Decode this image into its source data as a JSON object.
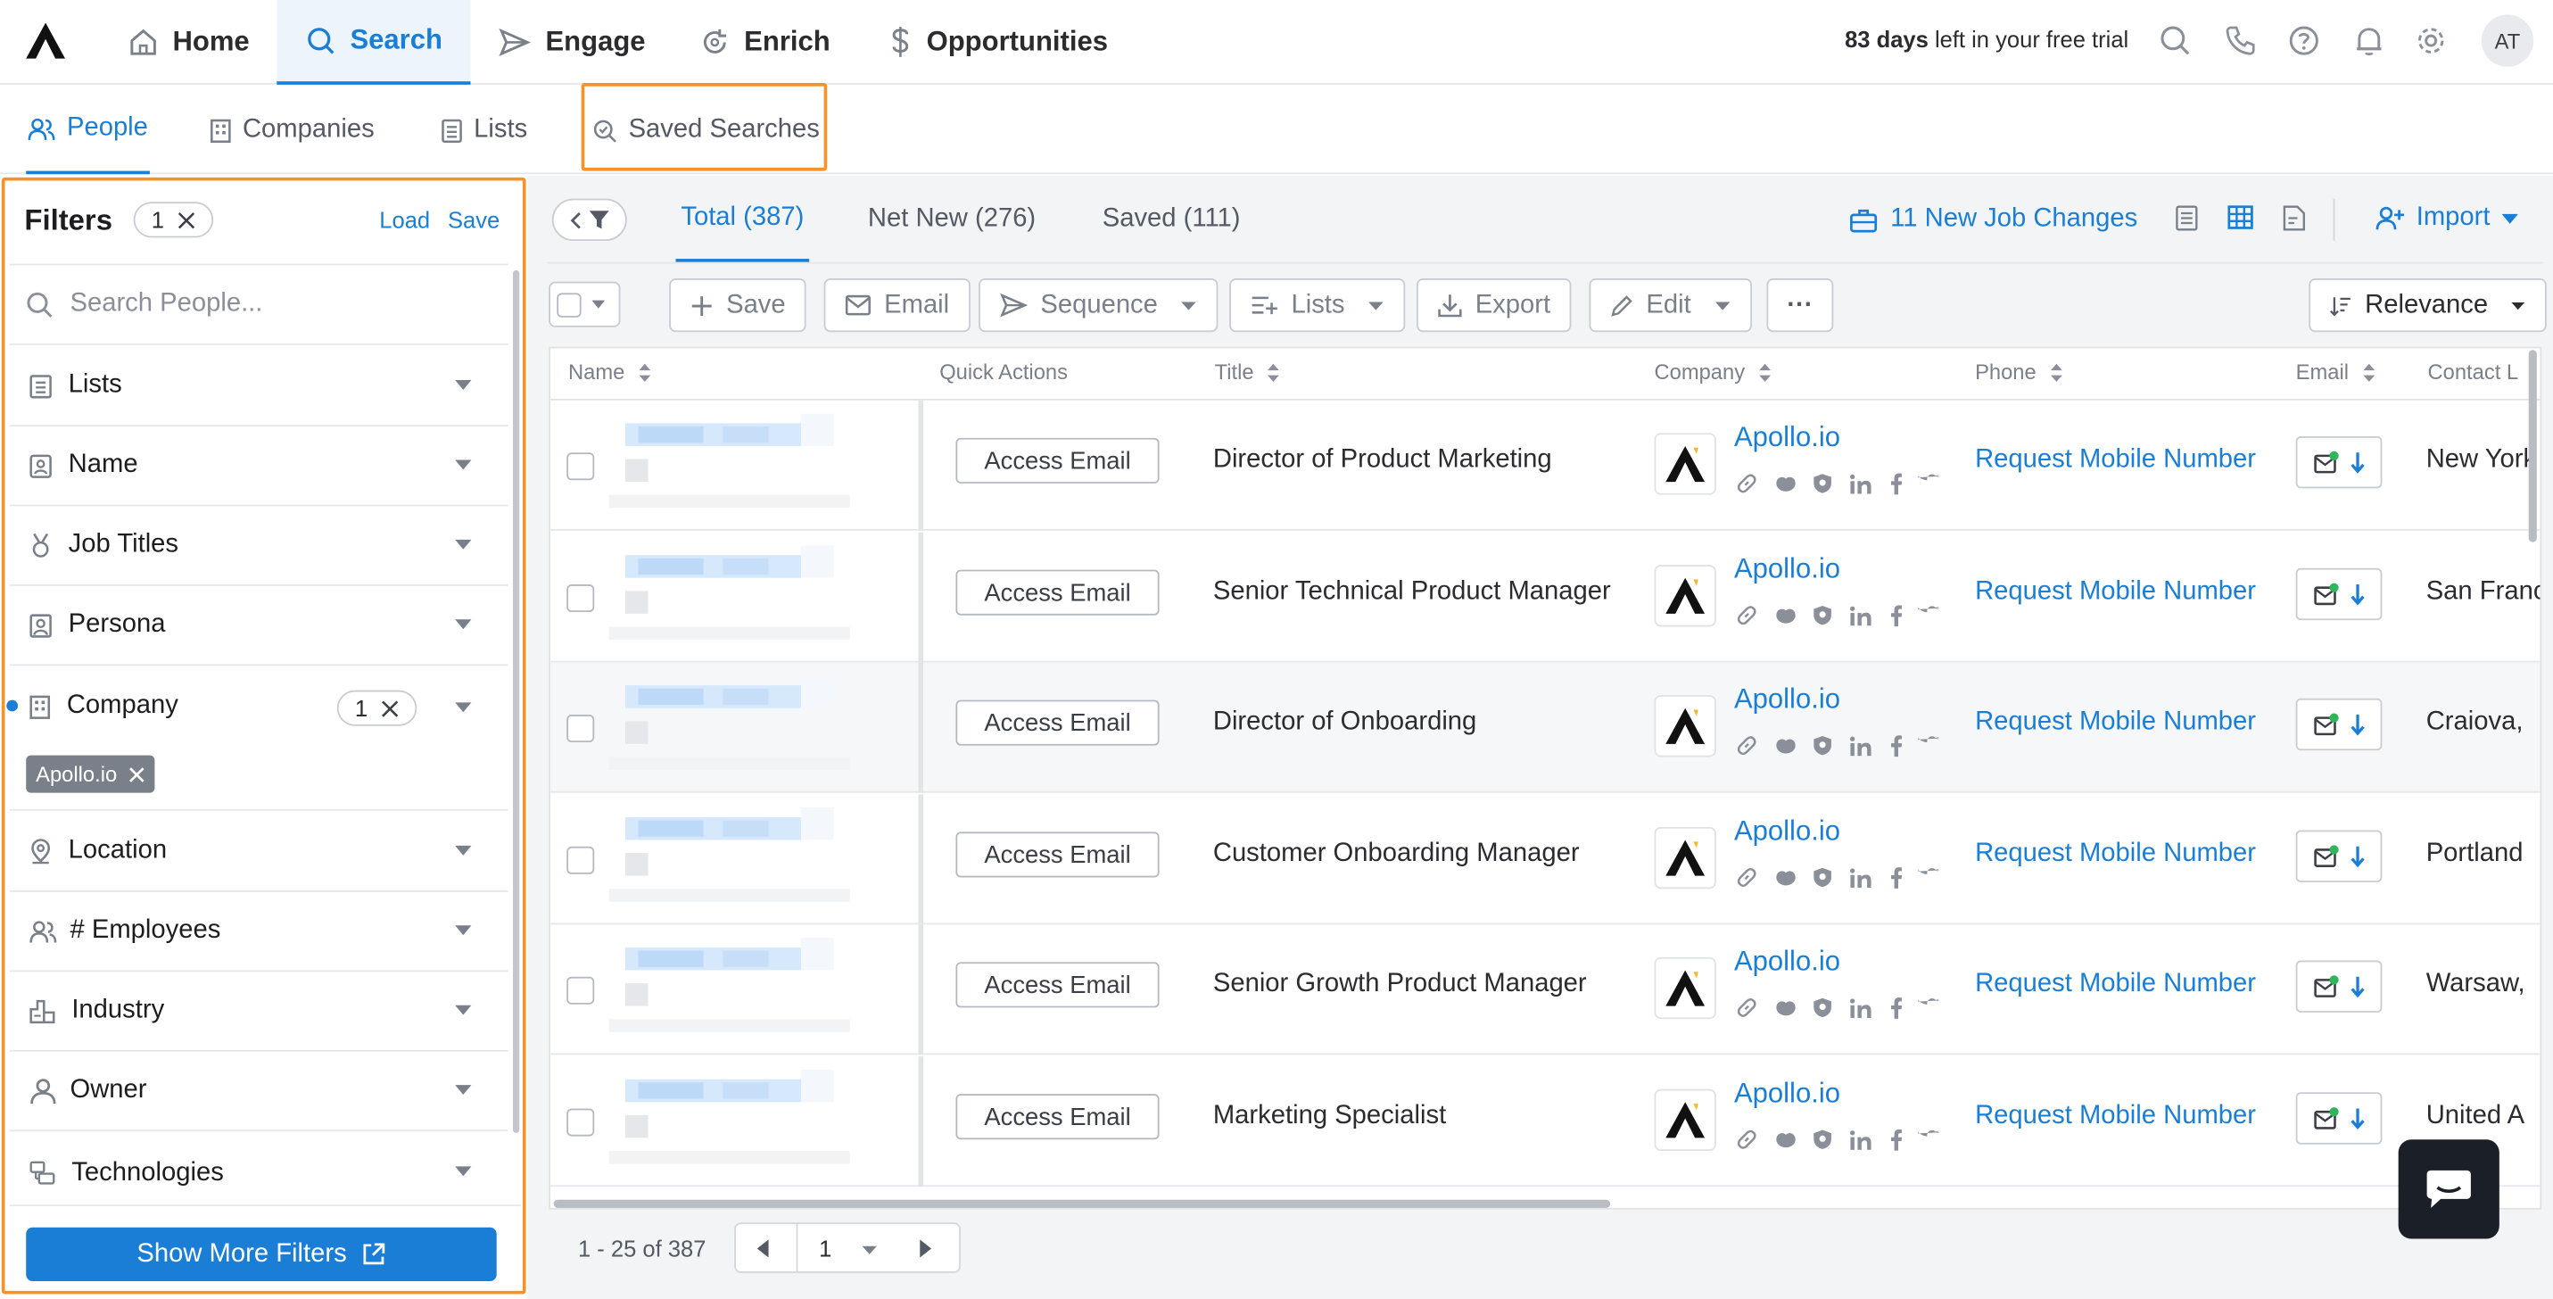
{
  "topnav": {
    "items": [
      {
        "label": "Home",
        "icon": "home-icon"
      },
      {
        "label": "Search",
        "icon": "search-icon"
      },
      {
        "label": "Engage",
        "icon": "send-icon"
      },
      {
        "label": "Enrich",
        "icon": "refresh-icon"
      },
      {
        "label": "Opportunities",
        "icon": "dollar-icon"
      }
    ],
    "trial_bold": "83 days",
    "trial_rest": " left in your free trial",
    "avatar": "AT"
  },
  "subnav": {
    "tabs": [
      {
        "label": "People",
        "icon": "people-icon"
      },
      {
        "label": "Companies",
        "icon": "building-icon"
      },
      {
        "label": "Lists",
        "icon": "list-icon"
      },
      {
        "label": "Saved Searches",
        "icon": "saved-search-icon"
      }
    ]
  },
  "filters": {
    "title": "Filters",
    "count": "1",
    "load": "Load",
    "save": "Save",
    "search_placeholder": "Search People...",
    "rows": [
      {
        "label": "Lists",
        "icon": "list-icon"
      },
      {
        "label": "Name",
        "icon": "id-badge-icon"
      },
      {
        "label": "Job Titles",
        "icon": "medal-icon"
      },
      {
        "label": "Persona",
        "icon": "persona-icon"
      },
      {
        "label": "Company",
        "icon": "building-icon",
        "count": "1"
      },
      {
        "label": "Location",
        "icon": "location-icon"
      },
      {
        "label": "# Employees",
        "icon": "people-icon"
      },
      {
        "label": "Industry",
        "icon": "industry-icon"
      },
      {
        "label": "Owner",
        "icon": "user-icon"
      },
      {
        "label": "Technologies",
        "icon": "tech-icon"
      }
    ],
    "company_chip": "Apollo.io",
    "show_more": "Show More Filters"
  },
  "views": {
    "tabs": [
      "Total (387)",
      "Net New (276)",
      "Saved (111)"
    ],
    "job_changes": "11 New Job Changes",
    "import": "Import"
  },
  "toolbar": {
    "save": "Save",
    "email": "Email",
    "sequence": "Sequence",
    "lists": "Lists",
    "export": "Export",
    "edit": "Edit",
    "more": "···",
    "sort": "Relevance"
  },
  "table": {
    "columns": [
      "Name",
      "Quick Actions",
      "Title",
      "Company",
      "Phone",
      "Email",
      "Contact L"
    ],
    "access_email": "Access Email",
    "phone_action": "Request Mobile Number",
    "rows": [
      {
        "title": "Director of Product Marketing",
        "company": "Apollo.io",
        "location": "New York"
      },
      {
        "title": "Senior Technical Product Manager",
        "company": "Apollo.io",
        "location": "San Francisco"
      },
      {
        "title": "Director of Onboarding",
        "company": "Apollo.io",
        "location": "Craiova,"
      },
      {
        "title": "Customer Onboarding Manager",
        "company": "Apollo.io",
        "location": "Portland"
      },
      {
        "title": "Senior Growth Product Manager",
        "company": "Apollo.io",
        "location": "Warsaw,"
      },
      {
        "title": "Marketing Specialist",
        "company": "Apollo.io",
        "location": "United A"
      }
    ]
  },
  "pager": {
    "range": "1 - 25 of 387",
    "page": "1"
  },
  "colors": {
    "accent": "#1a7ed6",
    "highlight": "#f5922a",
    "chat": "#1b1f27"
  }
}
